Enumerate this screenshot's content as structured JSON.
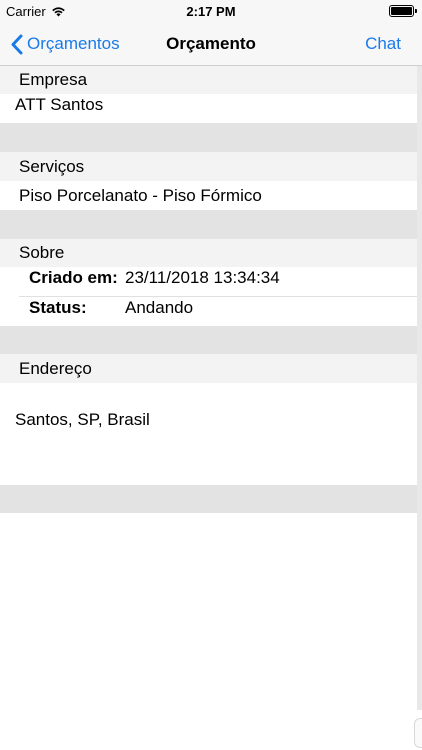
{
  "status_bar": {
    "carrier": "Carrier",
    "time": "2:17 PM",
    "battery_level": 1.0
  },
  "nav": {
    "back_label": "Orçamentos",
    "title": "Orçamento",
    "chat_label": "Chat"
  },
  "sections": {
    "empresa": {
      "header": "Empresa",
      "value": "ATT Santos"
    },
    "servicos": {
      "header": "Serviços",
      "value": "Piso Porcelanato - Piso Fórmico"
    },
    "sobre": {
      "header": "Sobre",
      "created_label": "Criado em:",
      "created_value": "23/11/2018 13:34:34",
      "status_label": "Status:",
      "status_value": "Andando"
    },
    "endereco": {
      "header": "Endereço",
      "value": "Santos, SP, Brasil"
    }
  },
  "colors": {
    "accent": "#1a7be8",
    "section_bg": "#f3f3f3",
    "gap_bg": "#e3e3e3"
  },
  "icons": [
    "wifi-icon",
    "battery-icon",
    "chevron-left-icon"
  ]
}
